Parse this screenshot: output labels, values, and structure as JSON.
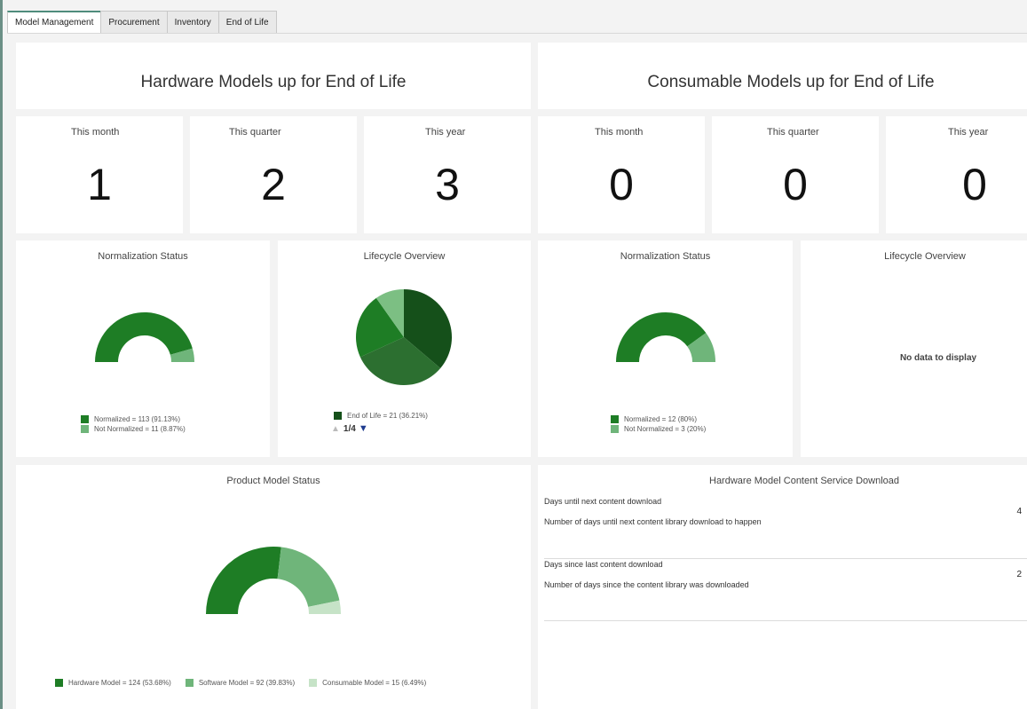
{
  "tabs": [
    {
      "label": "Model Management",
      "active": true
    },
    {
      "label": "Procurement",
      "active": false
    },
    {
      "label": "Inventory",
      "active": false
    },
    {
      "label": "End of Life",
      "active": false
    }
  ],
  "hardware": {
    "title": "Hardware Models up for End of Life",
    "stats": [
      {
        "label": "This month",
        "value": "1"
      },
      {
        "label": "This quarter",
        "value": "2"
      },
      {
        "label": "This year",
        "value": "3"
      }
    ],
    "normalization": {
      "title": "Normalization Status",
      "legend": [
        "Normalized = 113 (91.13%)",
        "Not Normalized = 11 (8.87%)"
      ]
    },
    "lifecycle": {
      "title": "Lifecycle Overview",
      "legend": "End of Life = 21 (36.21%)",
      "pager": "1/4"
    }
  },
  "consumable": {
    "title": "Consumable Models up for End of Life",
    "stats": [
      {
        "label": "This month",
        "value": "0"
      },
      {
        "label": "This quarter",
        "value": "0"
      },
      {
        "label": "This year",
        "value": "0"
      }
    ],
    "normalization": {
      "title": "Normalization Status",
      "legend": [
        "Normalized = 12 (80%)",
        "Not Normalized = 3 (20%)"
      ]
    },
    "lifecycle": {
      "title": "Lifecycle Overview",
      "empty_text": "No data to display"
    }
  },
  "product_status": {
    "title": "Product Model Status",
    "legend": [
      "Hardware Model = 124 (53.68%)",
      "Software Model = 92 (39.83%)",
      "Consumable Model = 15 (6.49%)"
    ]
  },
  "content_service": {
    "title": "Hardware Model Content Service Download",
    "rows": [
      {
        "title": "Days until next content download",
        "desc": "Number of days until next content library download to happen",
        "value": "4"
      },
      {
        "title": "Days since last content download",
        "desc": "Number of days since the content library was downloaded",
        "value": "2"
      }
    ]
  },
  "colors": {
    "dark_green": "#1e7d25",
    "medium_green": "#6fb57a",
    "light_green": "#c6e3c7",
    "deep_green": "#15501a",
    "accent_tab": "#4f8c7c",
    "pager_arrow": "#1f3c8f"
  },
  "chart_data": [
    {
      "type": "pie",
      "variant": "half-donut",
      "title": "Normalization Status",
      "categories": [
        "Normalized",
        "Not Normalized"
      ],
      "values": [
        113,
        11
      ],
      "percentages": [
        91.13,
        8.87
      ]
    },
    {
      "type": "pie",
      "title": "Lifecycle Overview",
      "categories": [
        "End of Life"
      ],
      "values": [
        21
      ],
      "percentages": [
        36.21
      ],
      "slice_percentages": [
        36.21,
        32,
        22,
        9.79
      ]
    },
    {
      "type": "pie",
      "variant": "half-donut",
      "title": "Normalization Status",
      "categories": [
        "Normalized",
        "Not Normalized"
      ],
      "values": [
        12,
        3
      ],
      "percentages": [
        80,
        20
      ]
    },
    {
      "type": "pie",
      "variant": "half-donut",
      "title": "Product Model Status",
      "categories": [
        "Hardware Model",
        "Software Model",
        "Consumable Model"
      ],
      "values": [
        124,
        92,
        15
      ],
      "percentages": [
        53.68,
        39.83,
        6.49
      ]
    }
  ]
}
